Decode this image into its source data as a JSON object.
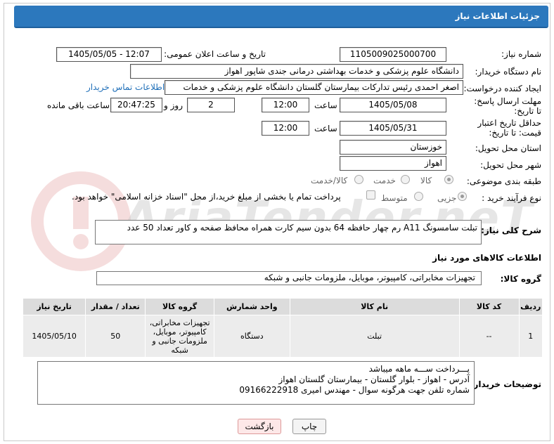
{
  "header": {
    "title": "جزئیات اطلاعات نیاز"
  },
  "fields": {
    "need_number_label": "شماره نیاز:",
    "need_number": "1105009025000700",
    "announce_label": "تاریخ و ساعت اعلان عمومی:",
    "announce_value": "1405/05/05 - 12:07",
    "buyer_label": "نام دستگاه خریدار:",
    "buyer_value": "دانشگاه علوم پزشکی و خدمات بهداشتی درمانی جندی شاپور اهواز",
    "requester_label": "ایجاد کننده درخواست:",
    "requester_value": "اصغر احمدی رئیس تدارکات بیمارستان گلستان دانشگاه علوم پزشکی و خدمات",
    "contact_link": "اطلاعات تماس خریدار",
    "reply_deadline_label": "مهلت ارسال پاسخ: تا تاریخ:",
    "reply_date": "1405/05/08",
    "time_label": "ساعت",
    "reply_time": "12:00",
    "days_value": "2",
    "days_label": "روز و",
    "remaining_time": "20:47:25",
    "remaining_label": "ساعت باقی مانده",
    "price_validity_label": "حداقل تاریخ اعتبار قیمت: تا تاریخ:",
    "price_date": "1405/05/31",
    "price_time": "12:00",
    "province_label": "استان محل تحویل:",
    "province_value": "خوزستان",
    "city_label": "شهر محل تحویل:",
    "city_value": "اهواز",
    "category_label": "طبقه بندی موضوعی:",
    "category_options": [
      "کالا",
      "خدمت",
      "کالا/خدمت"
    ],
    "process_label": "نوع فرآیند خرید :",
    "process_options": [
      "جزیی",
      "متوسط"
    ],
    "payment_note": "پرداخت تمام یا بخشی از مبلغ خرید،از محل \"اسناد خزانه اسلامی\" خواهد بود."
  },
  "description": {
    "label": "شرح کلی نیاز:",
    "value": "تبلت سامسونگ  A11 رم چهار حافظه 64 بدون سیم کارت همراه محافظ صفحه و کاور   تعداد 50 عدد"
  },
  "goods": {
    "section_title": "اطلاعات کالاهای مورد نیاز",
    "group_label": "گروه کالا:",
    "group_value": "تجهیزات مخابراتی، کامپیوتر، موبایل، ملزومات جانبی و شبکه"
  },
  "table": {
    "headers": [
      "ردیف",
      "کد کالا",
      "نام کالا",
      "واحد شمارش",
      "گروه کالا",
      "تعداد / مقدار",
      "تاریخ نیاز"
    ],
    "rows": [
      [
        "1",
        "--",
        "تبلت",
        "دستگاه",
        "تجهیزات مخابراتی، کامپیوتر، موبایل، ملزومات جانبی و شبکه",
        "50",
        "1405/05/10"
      ]
    ]
  },
  "buyer_notes": {
    "label": "توضیحات خریدار:",
    "lines": [
      "پـــرداخت ســـه ماهه میباشد",
      "آدرس - اهواز - بلوار گلستان - بیمارستان گلستان اهواز",
      "شماره تلفن جهت هرگونه سوال  - مهندس امیری 09166222918"
    ]
  },
  "buttons": {
    "print": "چاپ",
    "back": "بازگشت"
  },
  "colors": {
    "header_bg": "#2c78bd",
    "link": "#1f6fb8"
  }
}
